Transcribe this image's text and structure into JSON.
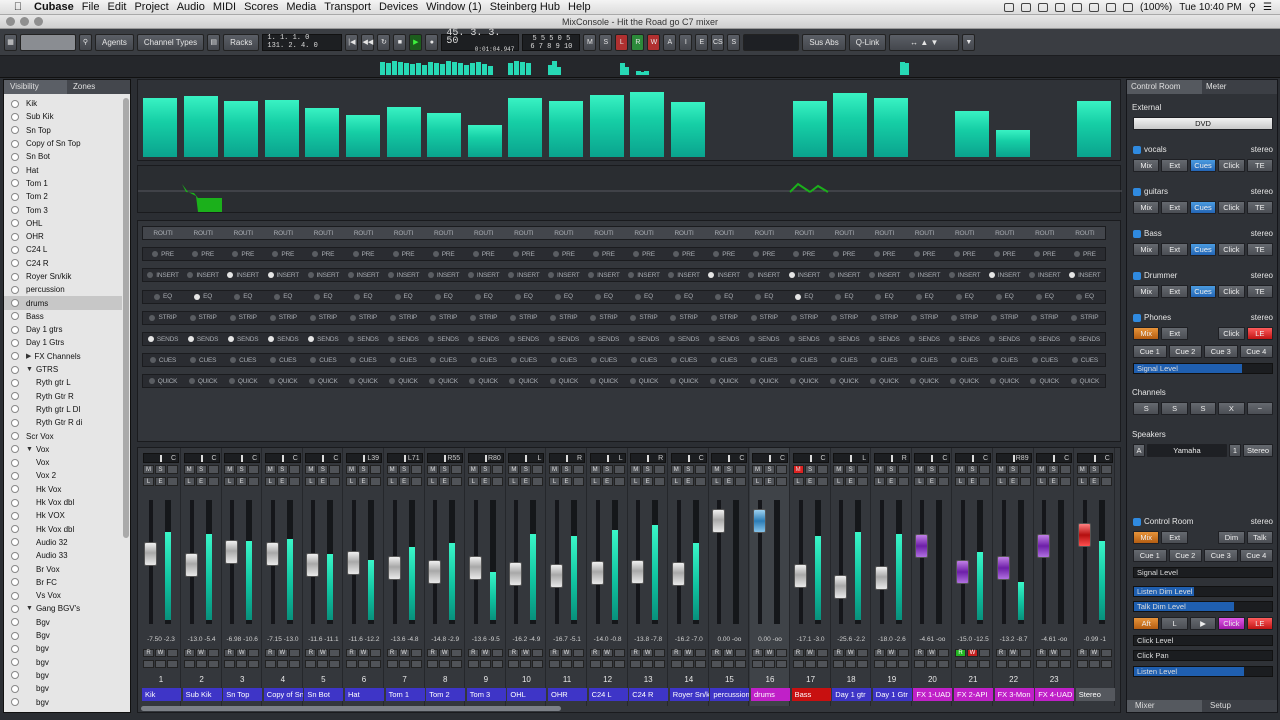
{
  "menubar": {
    "app": "Cubase",
    "items": [
      "File",
      "Edit",
      "Project",
      "Audio",
      "MIDI",
      "Scores",
      "Media",
      "Transport",
      "Devices",
      "Window (1)",
      "Steinberg Hub",
      "Help"
    ],
    "battery": "(100%)",
    "clock": "Tue 10:40 PM"
  },
  "window": {
    "title": "MixConsole - Hit the Road go C7 mixer"
  },
  "toolbar": {
    "agents": "Agents",
    "channel_types": "Channel Types",
    "racks": "Racks",
    "left_locator": "1. 1. 1. 0",
    "right_locator": "131. 2. 4. 0",
    "position_bars": "45. 3. 3. 50",
    "position_time": "0:01:04.947",
    "tempo_digits": "5 5 5 0 5",
    "tempo_digits2": "6 7 8 9 10",
    "sus_abs": "Sus Abs",
    "q_link": "Q-Link"
  },
  "left_panel": {
    "tabs": [
      "Visibility",
      "Zones"
    ],
    "items": [
      {
        "label": "Kik"
      },
      {
        "label": "Sub Kik"
      },
      {
        "label": "Sn Top"
      },
      {
        "label": "Copy of Sn Top"
      },
      {
        "label": "Sn Bot"
      },
      {
        "label": "Hat"
      },
      {
        "label": "Tom 1"
      },
      {
        "label": "Tom 2"
      },
      {
        "label": "Tom 3"
      },
      {
        "label": "OHL"
      },
      {
        "label": "OHR"
      },
      {
        "label": "C24 L"
      },
      {
        "label": "C24 R"
      },
      {
        "label": "Royer Sn/kik"
      },
      {
        "label": "percussion"
      },
      {
        "label": "drums",
        "sel": true
      },
      {
        "label": "Bass"
      },
      {
        "label": "Day 1 gtrs"
      },
      {
        "label": "Day 1 Gtrs"
      },
      {
        "label": "FX Channels",
        "folder": "right",
        "indent": 1
      },
      {
        "label": "GTRS",
        "folder": "down",
        "indent": 1
      },
      {
        "label": "Ryth gtr L",
        "indent": 2
      },
      {
        "label": "Ryth Gtr R",
        "indent": 2
      },
      {
        "label": "Ryth gtr L DI",
        "indent": 2
      },
      {
        "label": "Ryth Gtr R di",
        "indent": 2
      },
      {
        "label": "Scr Vox"
      },
      {
        "label": "Vox",
        "folder": "down",
        "indent": 1
      },
      {
        "label": "Vox",
        "indent": 2
      },
      {
        "label": "Vox 2",
        "indent": 2
      },
      {
        "label": "Hk Vox",
        "indent": 2
      },
      {
        "label": "Hk Vox dbl",
        "indent": 2
      },
      {
        "label": "Hk VOX",
        "indent": 2
      },
      {
        "label": "Hk Vox dbl",
        "indent": 2
      },
      {
        "label": "Audio 32",
        "indent": 2
      },
      {
        "label": "Audio 33",
        "indent": 2
      },
      {
        "label": "Br Vox",
        "indent": 2
      },
      {
        "label": "Br FC",
        "indent": 2
      },
      {
        "label": "Vs Vox",
        "indent": 2
      },
      {
        "label": "Gang BGV's",
        "folder": "down",
        "indent": 1
      },
      {
        "label": "Bgv",
        "indent": 2
      },
      {
        "label": "Bgv",
        "indent": 2
      },
      {
        "label": "bgv",
        "indent": 2
      },
      {
        "label": "bgv",
        "indent": 2
      },
      {
        "label": "bgv",
        "indent": 2
      },
      {
        "label": "bgv",
        "indent": 2
      },
      {
        "label": "bgv",
        "indent": 2
      }
    ]
  },
  "rack_labels": [
    "ROUTING",
    "PRE",
    "INSERT",
    "EQ",
    "STRIP",
    "SENDS",
    "CUES",
    "QUICK"
  ],
  "rack_short": {
    "ROUTING": "ROUTI"
  },
  "channels": [
    {
      "num": "1",
      "name": "Kik",
      "pan": "C",
      "vol": "-7.50",
      "peak": "-2.3",
      "color": "blue",
      "fader": 0.55,
      "level": 0.8
    },
    {
      "num": "2",
      "name": "Sub Kik",
      "pan": "C",
      "vol": "-13.0",
      "peak": "-5.4",
      "color": "blue",
      "fader": 0.45,
      "level": 0.78
    },
    {
      "num": "3",
      "name": "Sn Top",
      "pan": "C",
      "vol": "-6.98",
      "peak": "-10.6",
      "color": "blue",
      "fader": 0.56,
      "level": 0.72
    },
    {
      "num": "4",
      "name": "Copy of Sn Top",
      "pan": "C",
      "vol": "-7.15",
      "peak": "-13.0",
      "color": "blue",
      "fader": 0.55,
      "level": 0.74
    },
    {
      "num": "5",
      "name": "Sn Bot",
      "pan": "C",
      "vol": "-11.6",
      "peak": "-11.1",
      "color": "blue",
      "fader": 0.45,
      "level": 0.6
    },
    {
      "num": "6",
      "name": "Hat",
      "pan": "L39",
      "vol": "-11.6",
      "peak": "-12.2",
      "color": "blue",
      "fader": 0.46,
      "level": 0.55
    },
    {
      "num": "7",
      "name": "Tom 1",
      "pan": "L71",
      "vol": "-13.6",
      "peak": "-4.8",
      "color": "blue",
      "fader": 0.42,
      "level": 0.66
    },
    {
      "num": "8",
      "name": "Tom 2",
      "pan": "R55",
      "vol": "-14.8",
      "peak": "-2.9",
      "color": "blue",
      "fader": 0.38,
      "level": 0.7
    },
    {
      "num": "9",
      "name": "Tom 3",
      "pan": "R80",
      "vol": "-13.6",
      "peak": "-9.5",
      "color": "blue",
      "fader": 0.42,
      "level": 0.44
    },
    {
      "num": "10",
      "name": "OHL",
      "pan": "L",
      "vol": "-16.2",
      "peak": "-4.9",
      "color": "blue",
      "fader": 0.36,
      "level": 0.78
    },
    {
      "num": "11",
      "name": "OHR",
      "pan": "R",
      "vol": "-16.7",
      "peak": "-5.1",
      "color": "blue",
      "fader": 0.35,
      "level": 0.76
    },
    {
      "num": "12",
      "name": "C24 L",
      "pan": "L",
      "vol": "-14.0",
      "peak": "-0.8",
      "color": "blue",
      "fader": 0.37,
      "level": 0.82
    },
    {
      "num": "13",
      "name": "C24 R",
      "pan": "R",
      "vol": "-13.8",
      "peak": "-7.8",
      "color": "blue",
      "fader": 0.38,
      "level": 0.86
    },
    {
      "num": "14",
      "name": "Royer Sn/kik",
      "pan": "C",
      "vol": "-16.2",
      "peak": "-7.0",
      "color": "blue",
      "fader": 0.36,
      "level": 0.7
    },
    {
      "num": "15",
      "name": "percussion",
      "pan": "C",
      "vol": "0.00",
      "peak": "-oo",
      "color": "blue",
      "fader": 0.85,
      "level": 0.0
    },
    {
      "num": "16",
      "name": "drums",
      "pan": "C",
      "vol": "0.00",
      "peak": "-oo",
      "color": "mag",
      "fader": 0.85,
      "level": 0.0,
      "blue": true,
      "hl": true
    },
    {
      "num": "17",
      "name": "Bass",
      "pan": "C",
      "vol": "-17.1",
      "peak": "-3.0",
      "color": "red",
      "fader": 0.35,
      "level": 0.76,
      "mute": true
    },
    {
      "num": "18",
      "name": "Day 1 gtr",
      "pan": "L",
      "vol": "-25.6",
      "peak": "-2.2",
      "color": "blue",
      "fader": 0.25,
      "level": 0.8
    },
    {
      "num": "19",
      "name": "Day 1 Gtr",
      "pan": "R",
      "vol": "-18.0",
      "peak": "-2.6",
      "color": "blue",
      "fader": 0.33,
      "level": 0.78
    },
    {
      "num": "20",
      "name": "FX 1-UAD",
      "pan": "C",
      "vol": "-4.61",
      "peak": "-oo",
      "color": "mag",
      "fader": 0.62,
      "level": 0.0,
      "purple": true
    },
    {
      "num": "21",
      "name": "FX 2-API",
      "pan": "C",
      "vol": "-15.0",
      "peak": "-12.5",
      "color": "mag",
      "fader": 0.38,
      "level": 0.62,
      "purple": true,
      "rwgreen": true
    },
    {
      "num": "22",
      "name": "FX 3-Mon",
      "pan": "R89",
      "vol": "-13.2",
      "peak": "-8.7",
      "color": "mag",
      "fader": 0.42,
      "level": 0.35,
      "purple": true
    },
    {
      "num": "23",
      "name": "FX 4-UAD",
      "pan": "C",
      "vol": "-4.61",
      "peak": "-oo",
      "color": "mag",
      "fader": 0.62,
      "level": 0.0,
      "purple": true
    },
    {
      "num": "",
      "name": "Stereo",
      "pan": "C",
      "vol": "-0.99",
      "peak": "-1",
      "color": "grey",
      "fader": 0.72,
      "level": 0.72,
      "red": true
    }
  ],
  "meter_top": [
    0.78,
    0.8,
    0.74,
    0.75,
    0.65,
    0.55,
    0.66,
    0.58,
    0.42,
    0.78,
    0.74,
    0.82,
    0.86,
    0.72,
    0.0,
    0.0,
    0.74,
    0.84,
    0.78,
    0.0,
    0.6,
    0.35,
    0.0,
    0.74
  ],
  "control_room": {
    "tabs": [
      "Control Room",
      "Meter"
    ],
    "external_label": "External",
    "dvd": "DVD",
    "cues": [
      {
        "name": "vocals",
        "fmt": "stereo"
      },
      {
        "name": "guitars",
        "fmt": "stereo"
      },
      {
        "name": "Bass",
        "fmt": "stereo"
      },
      {
        "name": "Drummer",
        "fmt": "stereo"
      }
    ],
    "cue_buttons": [
      "Mix",
      "Ext",
      "Cues",
      "Click",
      "TE"
    ],
    "phones": {
      "name": "Phones",
      "fmt": "stereo",
      "buttons": [
        "Mix",
        "Ext",
        "",
        "Click",
        "LE"
      ],
      "cues": [
        "Cue 1",
        "Cue 2",
        "Cue 3",
        "Cue 4"
      ],
      "signal": "Signal Level"
    },
    "channels_label": "Channels",
    "channel_icons": [
      "S",
      "S",
      "S",
      "X",
      "~"
    ],
    "speakers_label": "Speakers",
    "speaker": {
      "a": "A",
      "name": "Yamaha",
      "num": "1",
      "fmt": "Stereo"
    },
    "control_room": {
      "name": "Control Room",
      "fmt": "stereo",
      "buttons": [
        "Mix",
        "Ext",
        "",
        "Dim",
        "Talk"
      ],
      "cues": [
        "Cue 1",
        "Cue 2",
        "Cue 3",
        "Cue 4"
      ],
      "signal": "Signal Level",
      "listen_dim": "Listen Dim Level",
      "talk_dim": "Talk Dim Level",
      "row3": [
        "Aft",
        "L",
        "▶",
        "Click",
        "LE"
      ],
      "click_level": "Click Level",
      "click_pan": "Click Pan",
      "listen_level": "Listen Level"
    },
    "bottom_tabs": [
      "Mixer",
      "Setup"
    ]
  }
}
